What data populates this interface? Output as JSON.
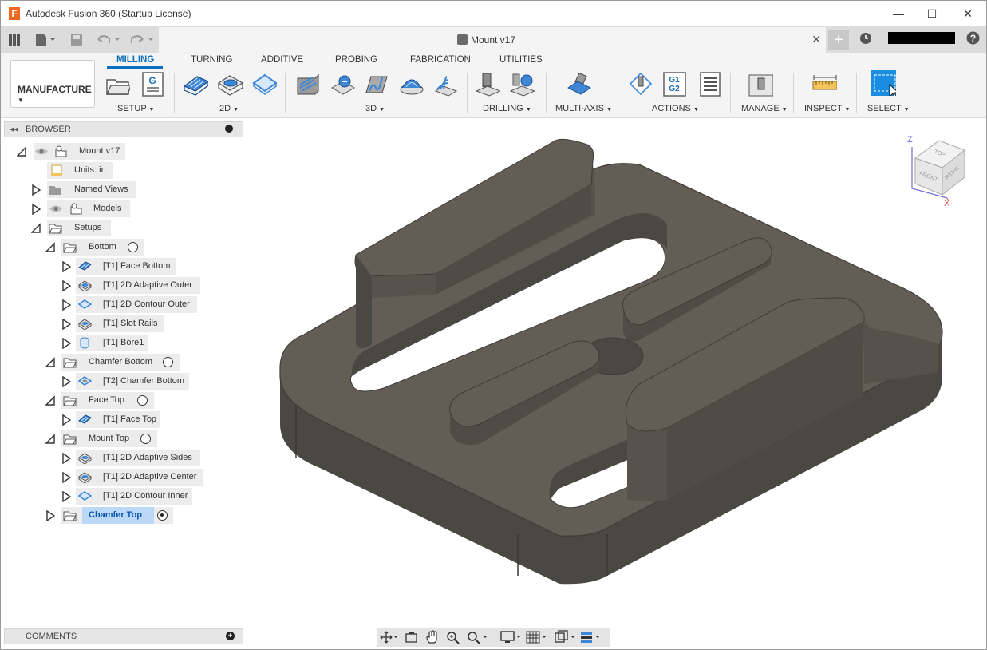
{
  "titlebar": {
    "app_title": "Autodesk Fusion 360 (Startup License)",
    "logo_letter": "F",
    "controls": [
      "—",
      "☐",
      "✕"
    ]
  },
  "document": {
    "title": "Mount v17",
    "close": "✕",
    "new_tab": "+"
  },
  "toolbar": {
    "workspace": "MANUFACTURE",
    "tabs": [
      "MILLING",
      "TURNING",
      "ADDITIVE",
      "PROBING",
      "FABRICATION",
      "UTILITIES"
    ],
    "active_tab": "MILLING",
    "groups": [
      "SETUP",
      "2D",
      "3D",
      "DRILLING",
      "MULTI-AXIS",
      "ACTIONS",
      "MANAGE",
      "INSPECT",
      "SELECT"
    ],
    "actions_g_text": [
      "G1",
      "G2"
    ],
    "accent_color": "#0b6fbd"
  },
  "browser": {
    "header": "BROWSER",
    "root": "Mount v17",
    "units": "Units: in",
    "named_views": "Named Views",
    "models": "Models",
    "setups": "Setups",
    "setup_bottom": "Bottom",
    "op_face_bottom": "[T1] Face Bottom",
    "op_adaptive_outer": "[T1] 2D Adaptive Outer",
    "op_contour_outer": "[T1] 2D Contour Outer",
    "op_slot_rails": "[T1] Slot Rails",
    "op_bore1": "[T1] Bore1",
    "setup_chamfer_bottom": "Chamfer Bottom",
    "op_chamfer_bottom": "[T2] Chamfer Bottom",
    "setup_face_top": "Face Top",
    "op_face_top": "[T1] Face Top",
    "setup_mount_top": "Mount Top",
    "op_adaptive_sides": "[T1] 2D Adaptive Sides",
    "op_adaptive_center": "[T1] 2D Adaptive Center",
    "op_contour_inner": "[T1] 2D Contour Inner",
    "setup_chamfer_top": "Chamfer Top",
    "selected_color": "#bcd8f7"
  },
  "comments": {
    "header": "COMMENTS"
  },
  "viewcube": {
    "top": "TOP",
    "front": "FRONT",
    "right": "RIGHT",
    "axis_z": "Z",
    "axis_x": "X"
  },
  "model": {
    "color": "#5e5b53"
  }
}
